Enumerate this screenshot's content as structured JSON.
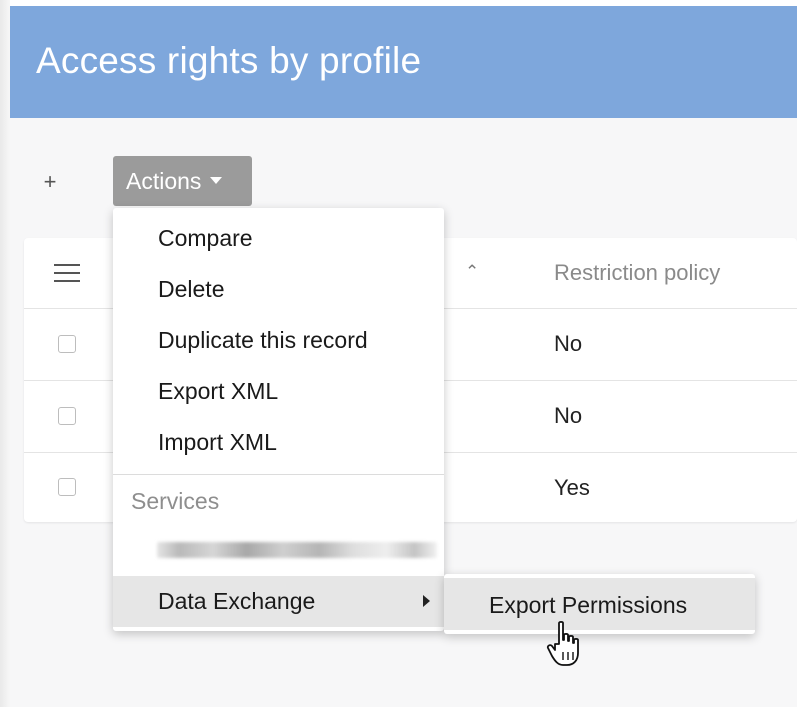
{
  "header": {
    "title": "Access rights by profile"
  },
  "toolbar": {
    "add_label": "+",
    "actions_label": "Actions"
  },
  "table": {
    "columns": [
      "Restriction policy"
    ],
    "rows": [
      {
        "restriction_policy": "No"
      },
      {
        "restriction_policy": "No"
      },
      {
        "restriction_policy": "Yes"
      }
    ]
  },
  "actions_menu": {
    "items": [
      "Compare",
      "Delete",
      "Duplicate this record",
      "Export XML",
      "Import XML"
    ],
    "section_label": "Services",
    "data_exchange_label": "Data Exchange"
  },
  "submenu": {
    "export_permissions_label": "Export Permissions"
  },
  "colors": {
    "header_bg": "#7ea7dc",
    "actions_bg": "#9b9b9b",
    "hover_bg": "#e6e6e6"
  }
}
